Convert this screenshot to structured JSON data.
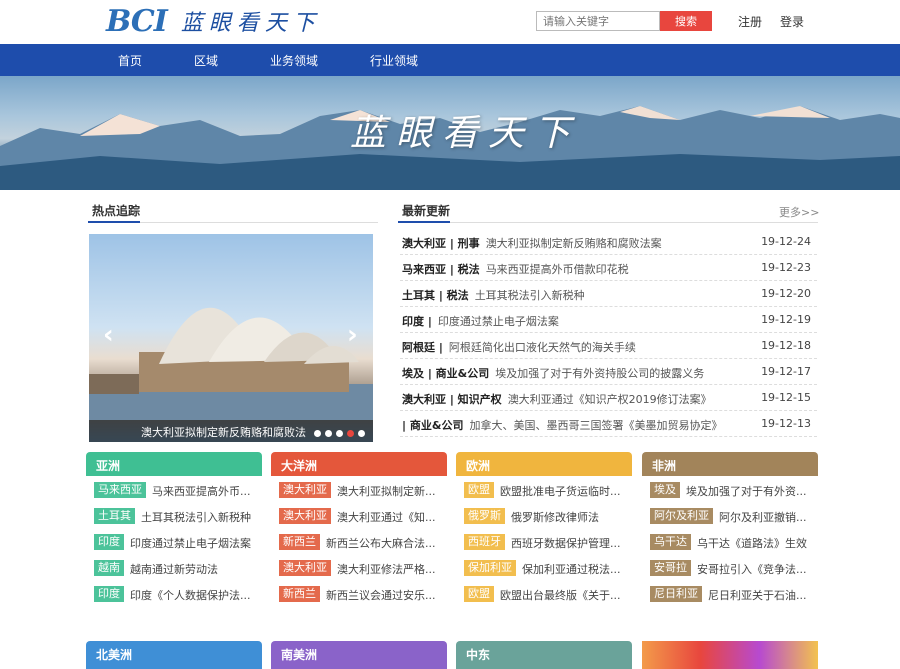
{
  "header": {
    "logo_latin": "BCI",
    "logo_cn": "蓝眼看天下",
    "search_placeholder": "请输入关键字",
    "search_button": "搜索",
    "register": "注册",
    "login": "登录"
  },
  "nav": [
    "首页",
    "区域",
    "业务领域",
    "行业领域"
  ],
  "banner": {
    "title": "蓝眼看天下"
  },
  "hot": {
    "heading": "热点追踪",
    "caption": "澳大利亚拟制定新反贿赂和腐败法"
  },
  "latest": {
    "heading": "最新更新",
    "more": "更多>>",
    "items": [
      {
        "tag": "澳大利亚 | 刑事",
        "title": "澳大利亚拟制定新反贿赂和腐败法案",
        "date": "19-12-24"
      },
      {
        "tag": "马来西亚 | 税法",
        "title": "马来西亚提高外币借款印花税",
        "date": "19-12-23"
      },
      {
        "tag": "土耳其 | 税法",
        "title": "土耳其税法引入新税种",
        "date": "19-12-20"
      },
      {
        "tag": "印度 |",
        "title": "印度通过禁止电子烟法案",
        "date": "19-12-19"
      },
      {
        "tag": "阿根廷 |",
        "title": "阿根廷简化出口液化天然气的海关手续",
        "date": "19-12-18"
      },
      {
        "tag": "埃及 | 商业&公司",
        "title": "埃及加强了对于有外资持股公司的披露义务",
        "date": "19-12-17"
      },
      {
        "tag": "澳大利亚 | 知识产权",
        "title": "澳大利亚通过《知识产权2019修订法案》",
        "date": "19-12-15"
      },
      {
        "tag": "| 商业&公司",
        "title": "加拿大、美国、墨西哥三国签署《美墨加贸易协定》",
        "date": "19-12-13"
      }
    ]
  },
  "regions": [
    {
      "name": "亚洲",
      "color": "#3fbf93",
      "pill": "#4cc39a",
      "rows": [
        {
          "tag": "马来西亚",
          "text": "马来西亚提高外币..."
        },
        {
          "tag": "土耳其",
          "text": "土耳其税法引入新税种"
        },
        {
          "tag": "印度",
          "text": "印度通过禁止电子烟法案"
        },
        {
          "tag": "越南",
          "text": "越南通过新劳动法"
        },
        {
          "tag": "印度",
          "text": "印度《个人数据保护法..."
        }
      ]
    },
    {
      "name": "大洋洲",
      "color": "#e4573b",
      "pill": "#e46a4c",
      "rows": [
        {
          "tag": "澳大利亚",
          "text": "澳大利亚拟制定新..."
        },
        {
          "tag": "澳大利亚",
          "text": "澳大利亚通过《知..."
        },
        {
          "tag": "新西兰",
          "text": "新西兰公布大麻合法..."
        },
        {
          "tag": "澳大利亚",
          "text": "澳大利亚修法严格..."
        },
        {
          "tag": "新西兰",
          "text": "新西兰议会通过安乐..."
        }
      ]
    },
    {
      "name": "欧洲",
      "color": "#f0b53e",
      "pill": "#f2be4e",
      "rows": [
        {
          "tag": "欧盟",
          "text": "欧盟批准电子货运临时..."
        },
        {
          "tag": "俄罗斯",
          "text": "俄罗斯修改律师法"
        },
        {
          "tag": "西班牙",
          "text": "西班牙数据保护管理..."
        },
        {
          "tag": "保加利亚",
          "text": "保加利亚通过税法..."
        },
        {
          "tag": "欧盟",
          "text": "欧盟出台最终版《关于..."
        }
      ]
    },
    {
      "name": "非洲",
      "color": "#a2845a",
      "pill": "#a88b62",
      "rows": [
        {
          "tag": "埃及",
          "text": "埃及加强了对于有外资..."
        },
        {
          "tag": "阿尔及利亚",
          "text": "阿尔及利亚撤销..."
        },
        {
          "tag": "乌干达",
          "text": "乌干达《道路法》生效"
        },
        {
          "tag": "安哥拉",
          "text": "安哥拉引入《竞争法..."
        },
        {
          "tag": "尼日利亚",
          "text": "尼日利亚关于石油..."
        }
      ]
    }
  ],
  "regions2": [
    {
      "name": "北美洲",
      "color": "#3f8fd6"
    },
    {
      "name": "南美洲",
      "color": "#8a63c9"
    },
    {
      "name": "中东",
      "color": "#6aa39a"
    }
  ]
}
